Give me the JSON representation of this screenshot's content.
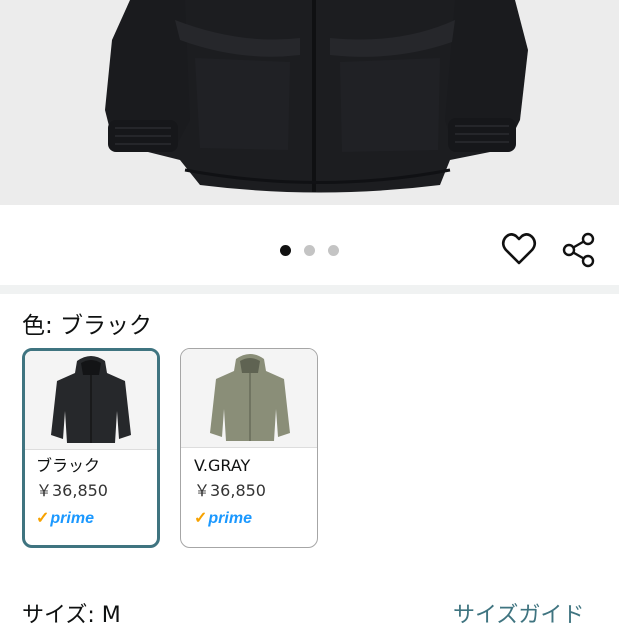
{
  "product_image": {
    "color": "#1c1d20",
    "pager": {
      "count": 3,
      "active_index": 0
    }
  },
  "actions": {
    "wishlist_icon": "heart-icon",
    "share_icon": "share-icon"
  },
  "color_section": {
    "label": "色: ブラック",
    "swatches": [
      {
        "name": "ブラック",
        "price": "￥36,850",
        "prime": "prime",
        "garment_color": "#26282b",
        "selected": true
      },
      {
        "name": "V.GRAY",
        "price": "￥36,850",
        "prime": "prime",
        "garment_color": "#8a8e78",
        "selected": false
      }
    ]
  },
  "size_section": {
    "label": "サイズ: M",
    "guide_link": "サイズガイド"
  },
  "colors": {
    "accent": "#3f7480",
    "prime_blue": "#1a98ff",
    "prime_check": "#f7a200"
  }
}
